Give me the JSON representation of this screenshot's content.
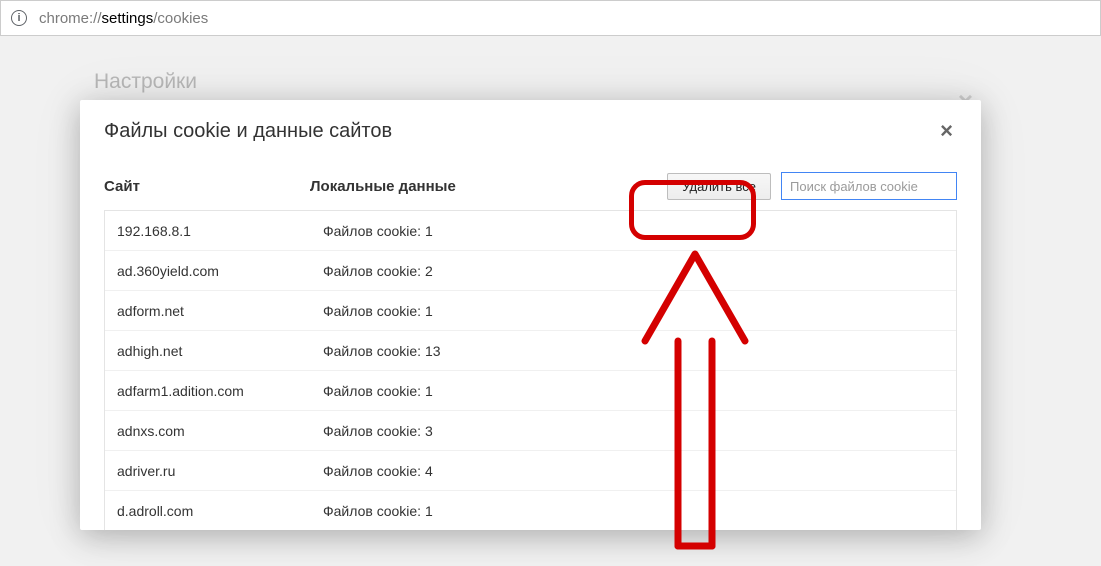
{
  "addressbar": {
    "url_gray1": "chrome://",
    "url_dark": "settings",
    "url_gray2": "/cookies"
  },
  "background": {
    "title": "Настройки"
  },
  "dialog": {
    "title": "Файлы cookie и данные сайтов",
    "close_glyph": "×",
    "columns": {
      "site": "Сайт",
      "local_data": "Локальные данные"
    },
    "delete_all_label": "Удалить все",
    "search_placeholder": "Поиск файлов cookie",
    "rows": [
      {
        "site": "192.168.8.1",
        "data": "Файлов cookie: 1"
      },
      {
        "site": "ad.360yield.com",
        "data": "Файлов cookie: 2"
      },
      {
        "site": "adform.net",
        "data": "Файлов cookie: 1"
      },
      {
        "site": "adhigh.net",
        "data": "Файлов cookie: 13"
      },
      {
        "site": "adfarm1.adition.com",
        "data": "Файлов cookie: 1"
      },
      {
        "site": "adnxs.com",
        "data": "Файлов cookie: 3"
      },
      {
        "site": "adriver.ru",
        "data": "Файлов cookie: 4"
      },
      {
        "site": "d.adroll.com",
        "data": "Файлов cookie: 1"
      }
    ]
  },
  "annotation": {
    "color": "#d40000"
  }
}
